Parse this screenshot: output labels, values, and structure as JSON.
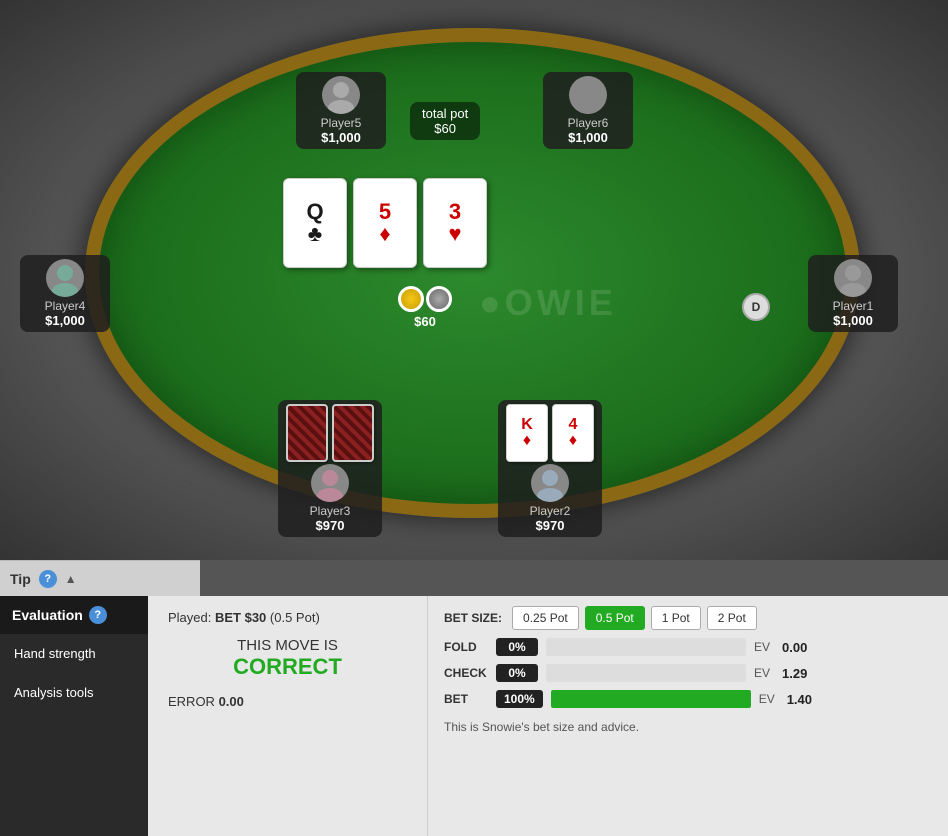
{
  "table": {
    "watermark": "●OWIE",
    "total_pot_label": "total pot",
    "total_pot_value": "$60",
    "chips_value": "$60"
  },
  "community_cards": [
    {
      "rank": "Q",
      "suit": "♣",
      "suit_class": "clubs"
    },
    {
      "rank": "5",
      "suit": "♦",
      "suit_class": "diamonds"
    },
    {
      "rank": "3",
      "suit": "♥",
      "suit_class": "hearts"
    }
  ],
  "players": {
    "player5": {
      "name": "Player5",
      "stack": "$1,000"
    },
    "player6": {
      "name": "Player6",
      "stack": "$1,000"
    },
    "player4": {
      "name": "Player4",
      "stack": "$1,000"
    },
    "player1": {
      "name": "Player1",
      "stack": "$1,000"
    },
    "player2": {
      "name": "Player2",
      "stack": "$970",
      "card1_rank": "K",
      "card1_suit": "♦",
      "card2_rank": "4",
      "card2_suit": "♦"
    },
    "player3": {
      "name": "Player3",
      "stack": "$970"
    }
  },
  "dealer_btn": "D",
  "tip_bar": {
    "label": "Tip",
    "collapse": "▲"
  },
  "sidebar": {
    "header": "Evaluation",
    "help": "?",
    "items": [
      {
        "label": "Hand strength"
      },
      {
        "label": "Analysis tools"
      }
    ]
  },
  "evaluation": {
    "played_label": "Played: BET $30 (0.5 Pot)",
    "this_move_is": "THIS MOVE IS",
    "correct": "CORRECT",
    "error_label": "ERROR",
    "error_value": "0.00"
  },
  "analysis": {
    "bet_size_label": "BET SIZE:",
    "bet_sizes": [
      {
        "label": "0.25 Pot",
        "active": false
      },
      {
        "label": "0.5 Pot",
        "active": true
      },
      {
        "label": "1 Pot",
        "active": false
      },
      {
        "label": "2 Pot",
        "active": false
      }
    ],
    "actions": [
      {
        "name": "FOLD",
        "pct": "0%",
        "bar_pct": 0,
        "ev_label": "EV",
        "ev_value": "0.00"
      },
      {
        "name": "CHECK",
        "pct": "0%",
        "bar_pct": 0,
        "ev_label": "EV",
        "ev_value": "1.29"
      },
      {
        "name": "BET",
        "pct": "100%",
        "bar_pct": 100,
        "ev_label": "EV",
        "ev_value": "1.40"
      }
    ],
    "advice": "This is Snowie's bet size and advice."
  }
}
